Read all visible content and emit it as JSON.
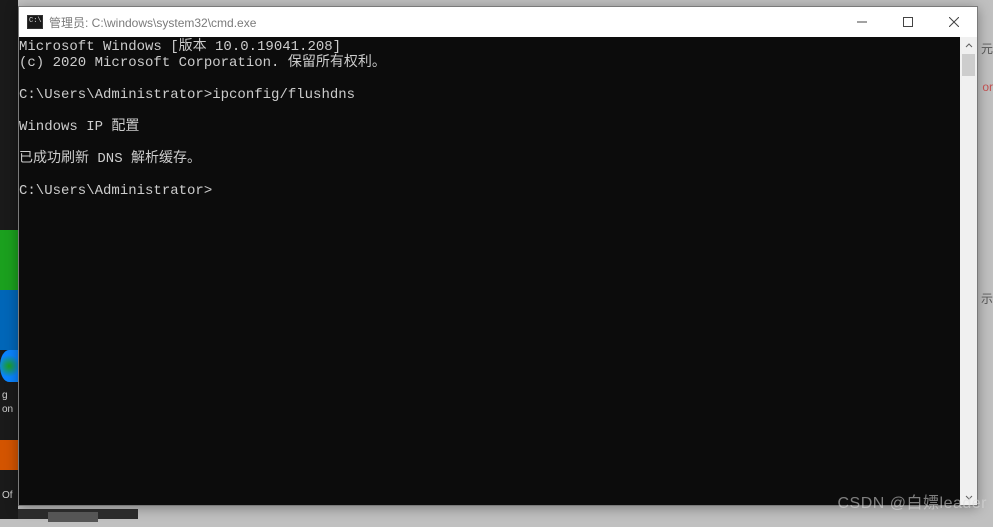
{
  "window": {
    "title": "管理员: C:\\windows\\system32\\cmd.exe"
  },
  "controls": {
    "minimize": "—",
    "maximize": "□",
    "close": "×"
  },
  "terminal": {
    "line1": "Microsoft Windows [版本 10.0.19041.208]",
    "line2": "(c) 2020 Microsoft Corporation. 保留所有权利。",
    "blank1": "",
    "prompt1": "C:\\Users\\Administrator>ipconfig/flushdns",
    "blank2": "",
    "line3": "Windows IP 配置",
    "blank3": "",
    "line4": "已成功刷新 DNS 解析缓存。",
    "blank4": "",
    "prompt2": "C:\\Users\\Administrator>"
  },
  "right_edge": {
    "r1": "元",
    "r2": "or",
    "r3": "示"
  },
  "left_edge": {
    "g": "g",
    "on": "on",
    "of": "Of"
  },
  "watermark": "CSDN @白嫖leader"
}
